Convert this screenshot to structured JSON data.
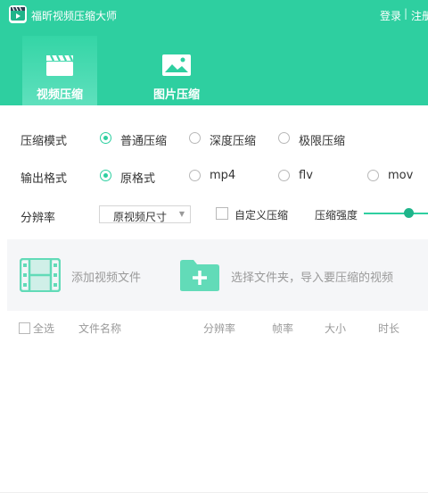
{
  "app": {
    "title": "福昕视频压缩大师",
    "login": "登录",
    "separator": "|",
    "register": "注册"
  },
  "tabs": [
    {
      "label": "视频压缩",
      "icon": "clapperboard-icon",
      "active": true
    },
    {
      "label": "图片压缩",
      "icon": "image-icon",
      "active": false
    }
  ],
  "settings": {
    "compress_mode": {
      "label": "压缩模式",
      "options": [
        "普通压缩",
        "深度压缩",
        "极限压缩"
      ],
      "selected": "普通压缩"
    },
    "output_format": {
      "label": "输出格式",
      "options": [
        "原格式",
        "mp4",
        "flv",
        "mov"
      ],
      "selected": "原格式"
    },
    "resolution": {
      "label": "分辨率",
      "value": "原视频尺寸",
      "custom_label": "自定义压缩",
      "strength_label": "压缩强度"
    }
  },
  "dropzone": {
    "add_file": "添加视频文件",
    "select_folder": "选择文件夹，导入要压缩的视频"
  },
  "table": {
    "select_all": "全选",
    "columns": [
      "文件名称",
      "分辨率",
      "帧率",
      "大小",
      "时长"
    ]
  },
  "colors": {
    "accent": "#2ecfa0",
    "accent_dark": "#1fb48a",
    "muted_text": "#9a9a9a"
  }
}
